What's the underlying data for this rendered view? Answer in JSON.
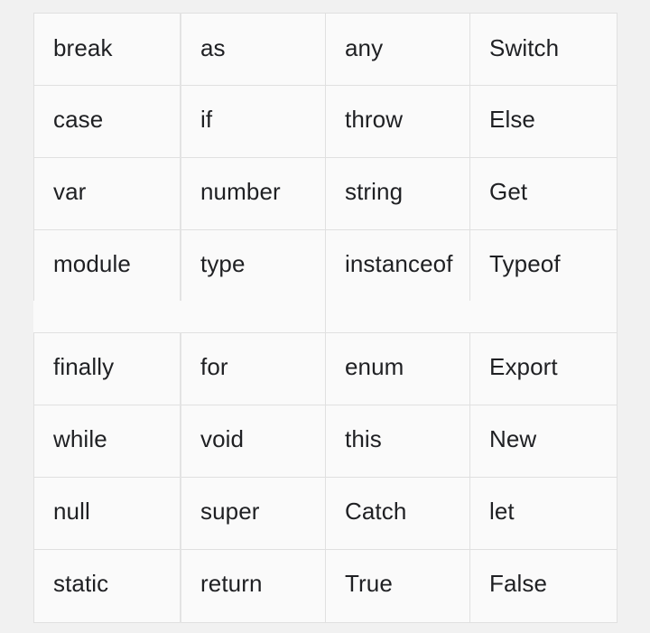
{
  "page": {
    "background_color": "#f1f1f1",
    "cell_background_color": "#fafafa",
    "border_color": "#e0e0e0",
    "text_color": "#1f2023"
  },
  "table": {
    "name": "programming-keywords-table",
    "column_count": 4,
    "row_count": 8,
    "rows": [
      {
        "cells": [
          "break",
          "as",
          "any",
          "Switch"
        ]
      },
      {
        "cells": [
          "case",
          "if",
          "throw",
          "Else"
        ]
      },
      {
        "cells": [
          "var",
          "number",
          "string",
          "Get"
        ]
      },
      {
        "cells": [
          "module",
          "type",
          "instanceof",
          "Typeof"
        ]
      },
      {
        "cells": [
          "finally",
          "for",
          "enum",
          "Export"
        ]
      },
      {
        "cells": [
          "while",
          "void",
          "this",
          "New"
        ]
      },
      {
        "cells": [
          "null",
          "super",
          "Catch",
          "let"
        ]
      },
      {
        "cells": [
          "static",
          "return",
          "True",
          "False"
        ]
      }
    ]
  }
}
